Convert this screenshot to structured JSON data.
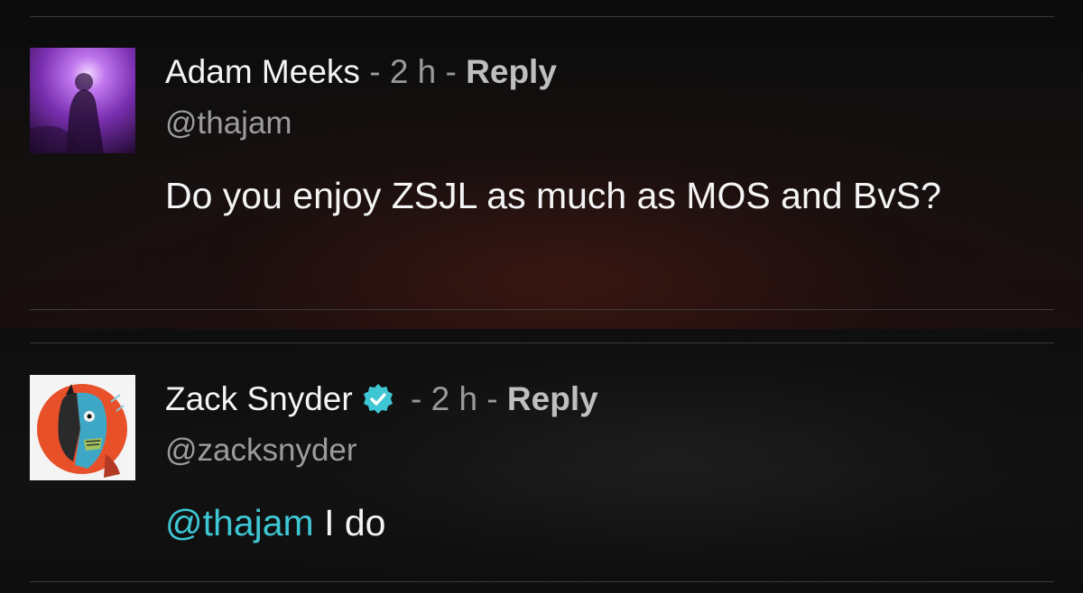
{
  "comments": [
    {
      "name": "Adam Meeks",
      "verified": false,
      "separator_1": " - ",
      "time": "2 h",
      "separator_2": " - ",
      "reply_label": "Reply",
      "handle": "@thajam",
      "text": "Do you enjoy ZSJL as much as MOS and BvS?"
    },
    {
      "name": "Zack Snyder",
      "verified": true,
      "separator_1": " - ",
      "time": "2 h",
      "separator_2": " - ",
      "reply_label": "Reply",
      "handle": "@zacksnyder",
      "mention": "@thajam",
      "text": " I do"
    }
  ],
  "colors": {
    "background": "#0b0b0b",
    "mention": "#3ec6d4",
    "verified_badge": "#3ec6d4",
    "meta_text": "#9a9a9a",
    "avatar_adam": "#7a2fb0",
    "avatar_zack": "#e8502a"
  },
  "icons": {
    "verified": "verified-check-icon"
  }
}
